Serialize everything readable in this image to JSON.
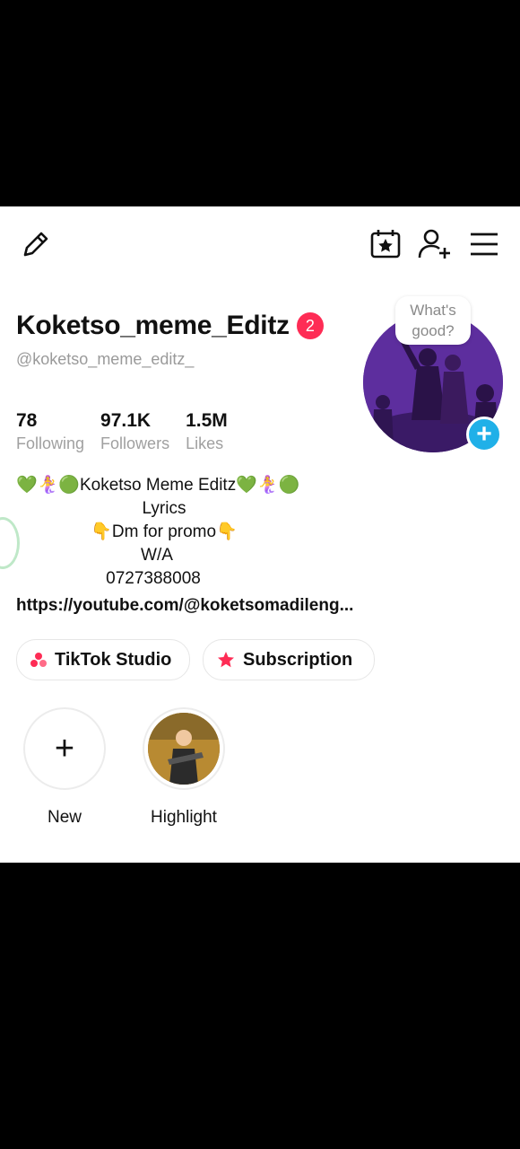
{
  "header": {
    "edit_icon": "pencil-icon",
    "calendar_icon": "calendar-star-icon",
    "add_friend_icon": "add-user-icon",
    "menu_icon": "hamburger-menu-icon"
  },
  "profile": {
    "username": "Koketso_meme_Editz",
    "notification_count": "2",
    "handle": "@koketso_meme_editz_",
    "avatar_prompt_line1": "What's",
    "avatar_prompt_line2": "good?",
    "avatar_add": "+"
  },
  "stats": [
    {
      "value": "78",
      "label": "Following"
    },
    {
      "value": "97.1K",
      "label": "Followers"
    },
    {
      "value": "1.5M",
      "label": "Likes"
    }
  ],
  "bio": {
    "line1": "💚🧜‍♀️🟢Koketso Meme Editz💚🧜‍♀️🟢",
    "line2": "Lyrics",
    "line3": "👇Dm for promo👇",
    "line4": "W/A",
    "line5": "0727388008",
    "link": "https://youtube.com/@koketsomadileng..."
  },
  "actions": {
    "studio_label": "TikTok Studio",
    "subscription_label": "Subscription"
  },
  "highlights": {
    "new_symbol": "+",
    "new_label": "New",
    "highlight_label": "Highlight"
  },
  "colors": {
    "accent_red": "#fe2c55",
    "add_blue": "#20b0e8",
    "avatar_purple": "#5b2b9c"
  }
}
